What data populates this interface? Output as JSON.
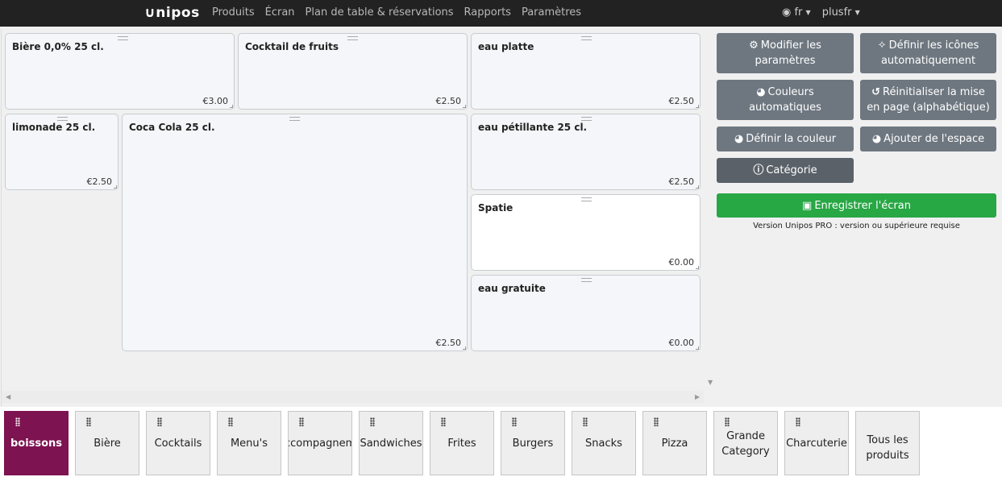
{
  "topbar": {
    "logo": "∪nipos",
    "nav": [
      "Produits",
      "Écran",
      "Plan de table & réservations",
      "Rapports",
      "Paramètres"
    ],
    "language": "fr",
    "user": "plusfr"
  },
  "tiles": [
    {
      "name": "Bière 0,0% 25 cl.",
      "price": "€3.00"
    },
    {
      "name": "Cocktail de fruits",
      "price": "€2.50"
    },
    {
      "name": "eau platte",
      "price": "€2.50"
    },
    {
      "name": "limonade 25 cl.",
      "price": "€2.50"
    },
    {
      "name": "Coca Cola 25 cl.",
      "price": "€2.50"
    },
    {
      "name": "eau pétillante 25 cl.",
      "price": "€2.50"
    },
    {
      "name": "Spatie",
      "price": "€0.00"
    },
    {
      "name": "eau gratuite",
      "price": "€0.00"
    }
  ],
  "sidebar": {
    "modify_params": "Modifier les paramètres",
    "auto_icons": "Définir les icônes automatiquement",
    "auto_colors": "Couleurs automatiques",
    "reset_layout": "Réinitialiser la mise en page (alphabétique)",
    "set_color": "Définir la couleur",
    "add_space": "Ajouter de l'espace",
    "category": "Catégorie",
    "save_screen": "Enregistrer l'écran",
    "version_note": "Version Unipos PRO : version ou supérieure requise"
  },
  "categories": [
    {
      "label": "boissons",
      "active": true
    },
    {
      "label": "Bière"
    },
    {
      "label": "Cocktails"
    },
    {
      "label": "Menu's"
    },
    {
      "label": "accompagnements"
    },
    {
      "label": "Sandwiches"
    },
    {
      "label": "Frites"
    },
    {
      "label": "Burgers"
    },
    {
      "label": "Snacks"
    },
    {
      "label": "Pizza"
    },
    {
      "label": "Grande Category"
    },
    {
      "label": "Charcuterie"
    },
    {
      "label": "Tous les produits"
    }
  ],
  "colors": {
    "topbar": "#222222",
    "active_category": "#7d1351",
    "save_button": "#28a745",
    "side_button": "#6e7780"
  }
}
